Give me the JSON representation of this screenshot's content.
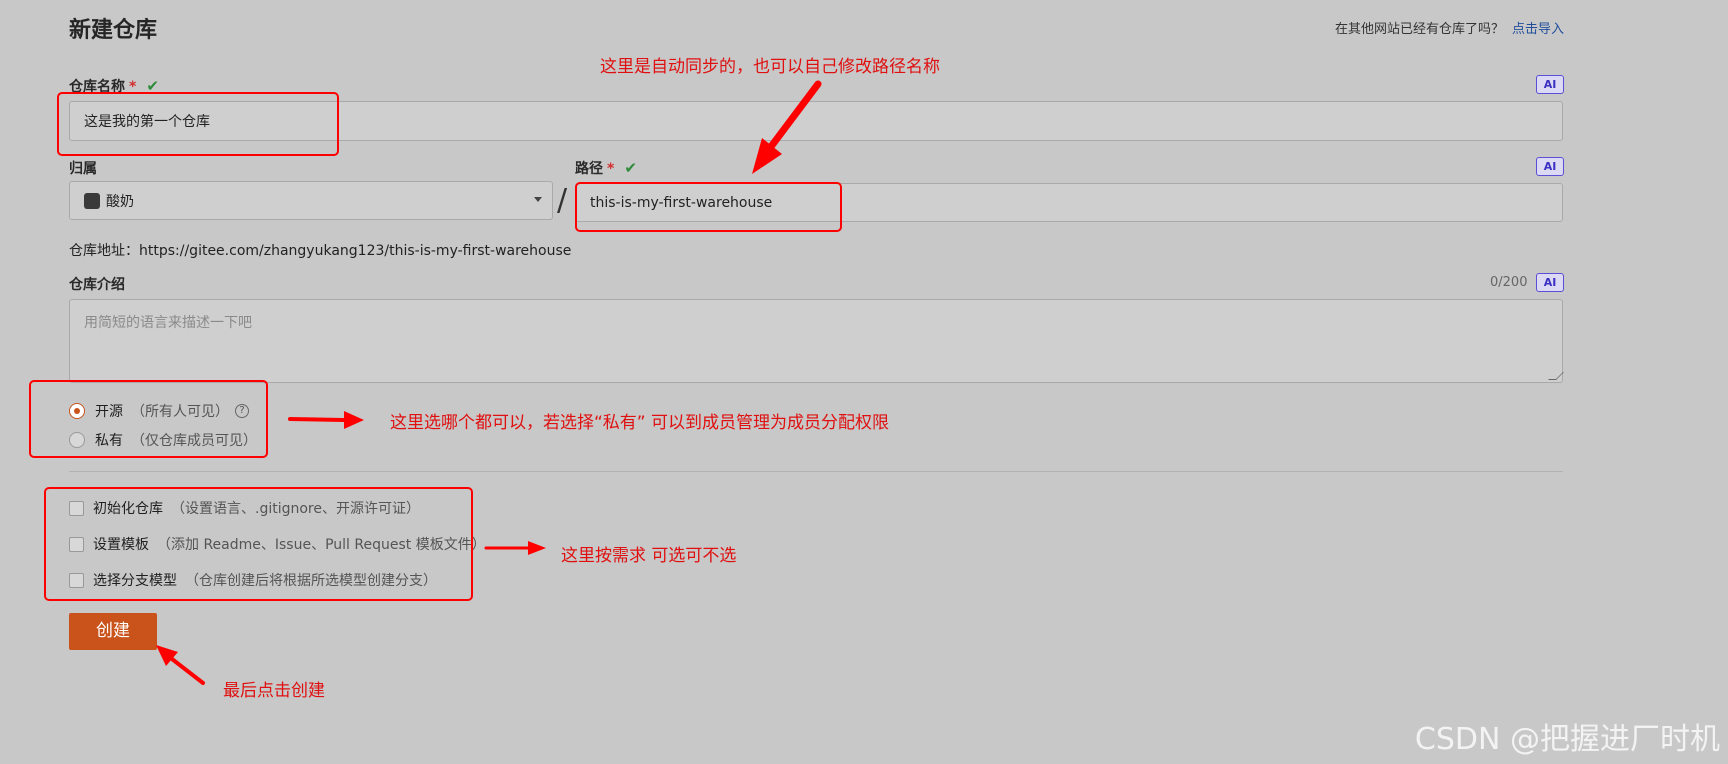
{
  "header": {
    "title": "新建仓库",
    "import_question": "在其他网站已经有仓库了吗？",
    "import_link": "点击导入"
  },
  "form": {
    "repo_name": {
      "label": "仓库名称",
      "required_mark": "*",
      "value": "这是我的第一个仓库",
      "ai_label": "AI"
    },
    "owner": {
      "label": "归属",
      "selected": "酸奶"
    },
    "separator": "/",
    "path": {
      "label": "路径",
      "required_mark": "*",
      "value": "this-is-my-first-warehouse",
      "ai_label": "AI"
    },
    "repo_url": {
      "label": "仓库地址：",
      "value": "https://gitee.com/zhangyukang123/this-is-my-first-warehouse"
    },
    "description": {
      "label": "仓库介绍",
      "placeholder": "用简短的语言来描述一下吧",
      "counter": "0/200",
      "ai_label": "AI"
    },
    "visibility": [
      {
        "label": "开源",
        "hint": "（所有人可见）",
        "selected": true
      },
      {
        "label": "私有",
        "hint": "（仅仓库成员可见）",
        "selected": false
      }
    ],
    "options": [
      {
        "label": "初始化仓库",
        "hint": "（设置语言、.gitignore、开源许可证）",
        "checked": false
      },
      {
        "label": "设置模板",
        "hint": "（添加 Readme、Issue、Pull Request 模板文件）",
        "checked": false
      },
      {
        "label": "选择分支模型",
        "hint": "（仓库创建后将根据所选模型创建分支）",
        "checked": false
      }
    ],
    "submit_label": "创建"
  },
  "annotations": {
    "path_note": "这里是自动同步的，也可以自己修改路径名称",
    "visibility_note": "这里选哪个都可以，若选择“私有” 可以到成员管理为成员分配权限",
    "options_note": "这里按需求 可选可不选",
    "create_note": "最后点击创建",
    "annotation_color": "#ff0000"
  },
  "watermark": "CSDN @把握进厂时机",
  "colors": {
    "accent": "#c9531b",
    "link": "#1f4e9c",
    "check": "#2e8b3a",
    "ai": "#5b4fd6"
  }
}
